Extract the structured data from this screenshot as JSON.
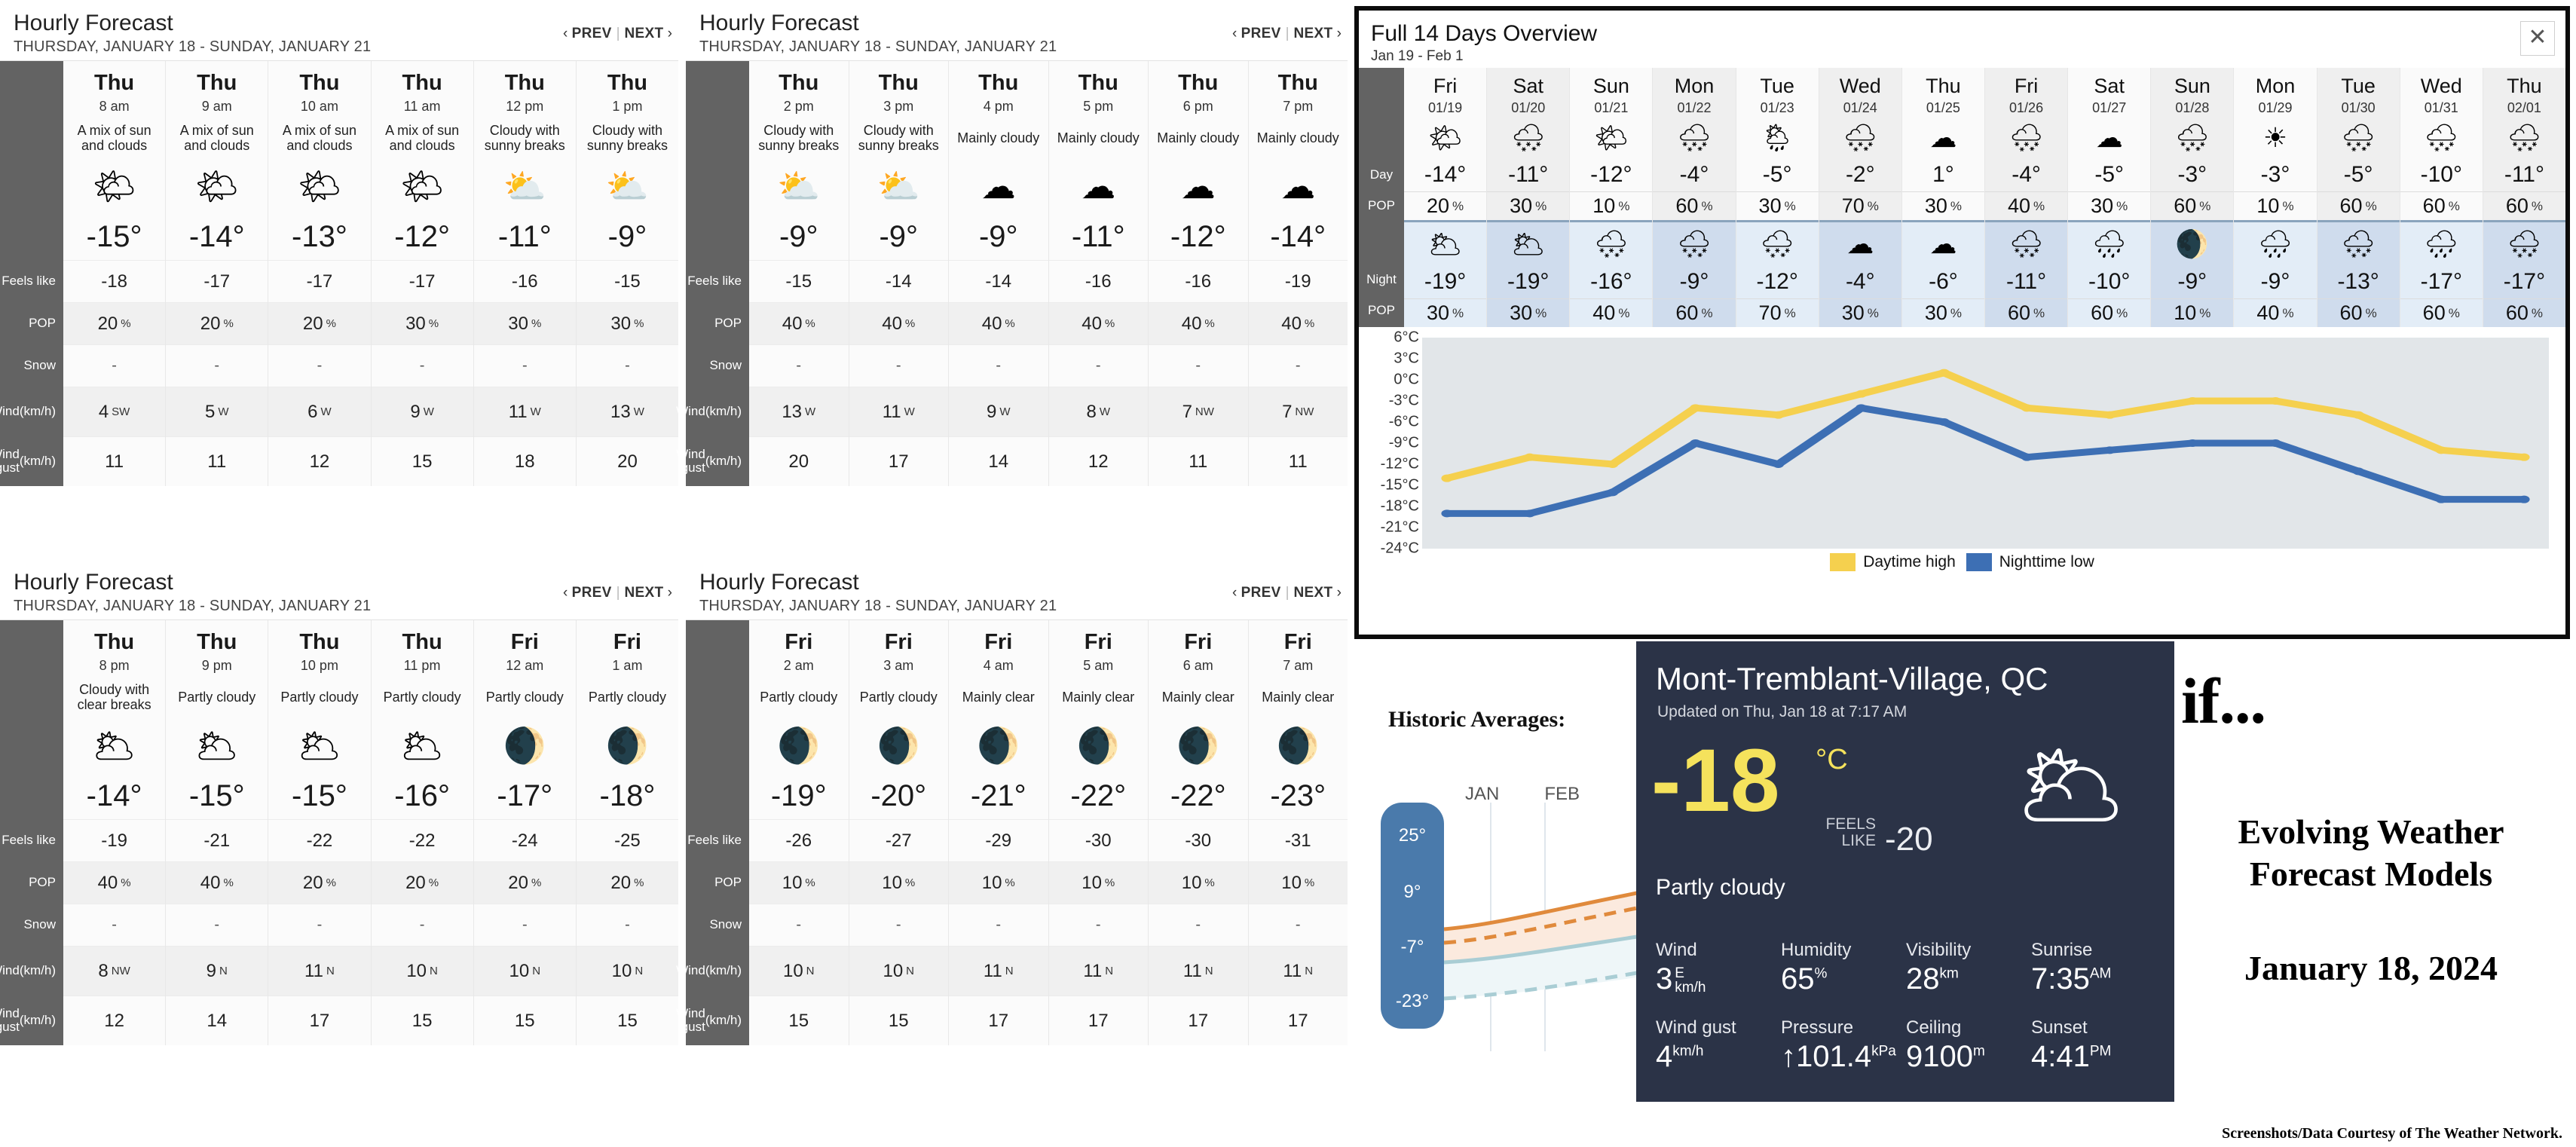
{
  "hourly_panels": [
    {
      "title": "Hourly Forecast",
      "subtitle": "THURSDAY, JANUARY 18 - SUNDAY, JANUARY 21",
      "prev_label": "PREV",
      "next_label": "NEXT",
      "row_labels": [
        "Feels like",
        "POP",
        "Snow",
        "Wind\n(km/h)",
        "Wind gust\n(km/h)"
      ],
      "columns": [
        {
          "day": "Thu",
          "time": "8 am",
          "cond": "A mix of sun and clouds",
          "icon": "sun-behind-cloud-icon",
          "glyph": "🌤",
          "temp": "-15°",
          "feels": "-18",
          "pop": "20",
          "pop_unit": "%",
          "snow": "-",
          "wind": "4",
          "wind_dir": "SW",
          "gust": "11"
        },
        {
          "day": "Thu",
          "time": "9 am",
          "cond": "A mix of sun and clouds",
          "icon": "sun-behind-cloud-icon",
          "glyph": "🌤",
          "temp": "-14°",
          "feels": "-17",
          "pop": "20",
          "pop_unit": "%",
          "snow": "-",
          "wind": "5",
          "wind_dir": "W",
          "gust": "11"
        },
        {
          "day": "Thu",
          "time": "10 am",
          "cond": "A mix of sun and clouds",
          "icon": "sun-behind-cloud-icon",
          "glyph": "🌤",
          "temp": "-13°",
          "feels": "-17",
          "pop": "20",
          "pop_unit": "%",
          "snow": "-",
          "wind": "6",
          "wind_dir": "W",
          "gust": "12"
        },
        {
          "day": "Thu",
          "time": "11 am",
          "cond": "A mix of sun and clouds",
          "icon": "sun-behind-cloud-icon",
          "glyph": "🌤",
          "temp": "-12°",
          "feels": "-17",
          "pop": "30",
          "pop_unit": "%",
          "snow": "-",
          "wind": "9",
          "wind_dir": "W",
          "gust": "15"
        },
        {
          "day": "Thu",
          "time": "12 pm",
          "cond": "Cloudy with sunny breaks",
          "icon": "sun-behind-large-cloud-icon",
          "glyph": "⛅",
          "temp": "-11°",
          "feels": "-16",
          "pop": "30",
          "pop_unit": "%",
          "snow": "-",
          "wind": "11",
          "wind_dir": "W",
          "gust": "18"
        },
        {
          "day": "Thu",
          "time": "1 pm",
          "cond": "Cloudy with sunny breaks",
          "icon": "sun-behind-large-cloud-icon",
          "glyph": "⛅",
          "temp": "-9°",
          "feels": "-15",
          "pop": "30",
          "pop_unit": "%",
          "snow": "-",
          "wind": "13",
          "wind_dir": "W",
          "gust": "20"
        }
      ]
    },
    {
      "title": "Hourly Forecast",
      "subtitle": "THURSDAY, JANUARY 18 - SUNDAY, JANUARY 21",
      "prev_label": "PREV",
      "next_label": "NEXT",
      "row_labels": [
        "Feels like",
        "POP",
        "Snow",
        "Wind\n(km/h)",
        "Wind gust\n(km/h)"
      ],
      "columns": [
        {
          "day": "Thu",
          "time": "2 pm",
          "cond": "Cloudy with sunny breaks",
          "icon": "sun-behind-large-cloud-icon",
          "glyph": "⛅",
          "temp": "-9°",
          "feels": "-15",
          "pop": "40",
          "pop_unit": "%",
          "snow": "-",
          "wind": "13",
          "wind_dir": "W",
          "gust": "20"
        },
        {
          "day": "Thu",
          "time": "3 pm",
          "cond": "Cloudy with sunny breaks",
          "icon": "sun-behind-large-cloud-icon",
          "glyph": "⛅",
          "temp": "-9°",
          "feels": "-14",
          "pop": "40",
          "pop_unit": "%",
          "snow": "-",
          "wind": "11",
          "wind_dir": "W",
          "gust": "17"
        },
        {
          "day": "Thu",
          "time": "4 pm",
          "cond": "Mainly cloudy",
          "icon": "cloud-icon",
          "glyph": "☁",
          "temp": "-9°",
          "feels": "-14",
          "pop": "40",
          "pop_unit": "%",
          "snow": "-",
          "wind": "9",
          "wind_dir": "W",
          "gust": "14"
        },
        {
          "day": "Thu",
          "time": "5 pm",
          "cond": "Mainly cloudy",
          "icon": "cloud-icon",
          "glyph": "☁",
          "temp": "-11°",
          "feels": "-16",
          "pop": "40",
          "pop_unit": "%",
          "snow": "-",
          "wind": "8",
          "wind_dir": "W",
          "gust": "12"
        },
        {
          "day": "Thu",
          "time": "6 pm",
          "cond": "Mainly cloudy",
          "icon": "cloud-icon",
          "glyph": "☁",
          "temp": "-12°",
          "feels": "-16",
          "pop": "40",
          "pop_unit": "%",
          "snow": "-",
          "wind": "7",
          "wind_dir": "NW",
          "gust": "11"
        },
        {
          "day": "Thu",
          "time": "7 pm",
          "cond": "Mainly cloudy",
          "icon": "cloud-icon",
          "glyph": "☁",
          "temp": "-14°",
          "feels": "-19",
          "pop": "40",
          "pop_unit": "%",
          "snow": "-",
          "wind": "7",
          "wind_dir": "NW",
          "gust": "11"
        }
      ]
    },
    {
      "title": "Hourly Forecast",
      "subtitle": "THURSDAY, JANUARY 18 - SUNDAY, JANUARY 21",
      "prev_label": "PREV",
      "next_label": "NEXT",
      "row_labels": [
        "Feels like",
        "POP",
        "Snow",
        "Wind\n(km/h)",
        "Wind gust\n(km/h)"
      ],
      "columns": [
        {
          "day": "Thu",
          "time": "8 pm",
          "cond": "Cloudy with clear breaks",
          "icon": "moon-behind-cloud-icon",
          "glyph": "🌥",
          "temp": "-14°",
          "feels": "-19",
          "pop": "40",
          "pop_unit": "%",
          "snow": "-",
          "wind": "8",
          "wind_dir": "NW",
          "gust": "12"
        },
        {
          "day": "Thu",
          "time": "9 pm",
          "cond": "Partly cloudy",
          "icon": "moon-behind-cloud-icon",
          "glyph": "🌥",
          "temp": "-15°",
          "feels": "-21",
          "pop": "40",
          "pop_unit": "%",
          "snow": "-",
          "wind": "9",
          "wind_dir": "N",
          "gust": "14"
        },
        {
          "day": "Thu",
          "time": "10 pm",
          "cond": "Partly cloudy",
          "icon": "moon-behind-cloud-icon",
          "glyph": "🌥",
          "temp": "-15°",
          "feels": "-22",
          "pop": "20",
          "pop_unit": "%",
          "snow": "-",
          "wind": "11",
          "wind_dir": "N",
          "gust": "17"
        },
        {
          "day": "Thu",
          "time": "11 pm",
          "cond": "Partly cloudy",
          "icon": "moon-behind-cloud-icon",
          "glyph": "🌥",
          "temp": "-16°",
          "feels": "-22",
          "pop": "20",
          "pop_unit": "%",
          "snow": "-",
          "wind": "10",
          "wind_dir": "N",
          "gust": "15"
        },
        {
          "day": "Fri",
          "time": "12 am",
          "cond": "Partly cloudy",
          "icon": "moon-behind-small-cloud-icon",
          "glyph": "🌒",
          "temp": "-17°",
          "feels": "-24",
          "pop": "20",
          "pop_unit": "%",
          "snow": "-",
          "wind": "10",
          "wind_dir": "N",
          "gust": "15"
        },
        {
          "day": "Fri",
          "time": "1 am",
          "cond": "Partly cloudy",
          "icon": "moon-behind-small-cloud-icon",
          "glyph": "🌒",
          "temp": "-18°",
          "feels": "-25",
          "pop": "20",
          "pop_unit": "%",
          "snow": "-",
          "wind": "10",
          "wind_dir": "N",
          "gust": "15"
        }
      ]
    },
    {
      "title": "Hourly Forecast",
      "subtitle": "THURSDAY, JANUARY 18 - SUNDAY, JANUARY 21",
      "prev_label": "PREV",
      "next_label": "NEXT",
      "row_labels": [
        "Feels like",
        "POP",
        "Snow",
        "Wind\n(km/h)",
        "Wind gust\n(km/h)"
      ],
      "columns": [
        {
          "day": "Fri",
          "time": "2 am",
          "cond": "Partly cloudy",
          "icon": "moon-behind-small-cloud-icon",
          "glyph": "🌒",
          "temp": "-19°",
          "feels": "-26",
          "pop": "10",
          "pop_unit": "%",
          "snow": "-",
          "wind": "10",
          "wind_dir": "N",
          "gust": "15"
        },
        {
          "day": "Fri",
          "time": "3 am",
          "cond": "Partly cloudy",
          "icon": "moon-behind-small-cloud-icon",
          "glyph": "🌒",
          "temp": "-20°",
          "feels": "-27",
          "pop": "10",
          "pop_unit": "%",
          "snow": "-",
          "wind": "10",
          "wind_dir": "N",
          "gust": "15"
        },
        {
          "day": "Fri",
          "time": "4 am",
          "cond": "Mainly clear",
          "icon": "crescent-moon-icon",
          "glyph": "🌒",
          "temp": "-21°",
          "feels": "-29",
          "pop": "10",
          "pop_unit": "%",
          "snow": "-",
          "wind": "11",
          "wind_dir": "N",
          "gust": "17"
        },
        {
          "day": "Fri",
          "time": "5 am",
          "cond": "Mainly clear",
          "icon": "crescent-moon-icon",
          "glyph": "🌒",
          "temp": "-22°",
          "feels": "-30",
          "pop": "10",
          "pop_unit": "%",
          "snow": "-",
          "wind": "11",
          "wind_dir": "N",
          "gust": "17"
        },
        {
          "day": "Fri",
          "time": "6 am",
          "cond": "Mainly clear",
          "icon": "crescent-moon-icon",
          "glyph": "🌒",
          "temp": "-22°",
          "feels": "-30",
          "pop": "10",
          "pop_unit": "%",
          "snow": "-",
          "wind": "11",
          "wind_dir": "N",
          "gust": "17"
        },
        {
          "day": "Fri",
          "time": "7 am",
          "cond": "Mainly clear",
          "icon": "crescent-moon-icon",
          "glyph": "🌒",
          "temp": "-23°",
          "feels": "-31",
          "pop": "10",
          "pop_unit": "%",
          "snow": "-",
          "wind": "11",
          "wind_dir": "N",
          "gust": "17"
        }
      ]
    }
  ],
  "overview": {
    "title": "Full 14 Days Overview",
    "subtitle": "Jan 19 - Feb 1",
    "close_icon": "close-icon",
    "row_labels": {
      "day": "Day",
      "day_pop": "POP",
      "night": "Night",
      "night_pop": "POP"
    },
    "days": [
      {
        "dow": "Fri",
        "date": "01/19",
        "day_icon": "sun-behind-cloud-icon",
        "day_glyph": "🌤",
        "day_temp": "-14°",
        "day_pop": "20",
        "night_icon": "moon-behind-cloud-icon",
        "night_glyph": "🌥",
        "night_temp": "-19°",
        "night_pop": "30"
      },
      {
        "dow": "Sat",
        "date": "01/20",
        "day_icon": "cloud-with-snow-icon",
        "day_glyph": "🌨",
        "day_temp": "-11°",
        "day_pop": "30",
        "night_icon": "moon-behind-cloud-icon",
        "night_glyph": "🌥",
        "night_temp": "-19°",
        "night_pop": "30"
      },
      {
        "dow": "Sun",
        "date": "01/21",
        "day_icon": "sun-behind-cloud-icon",
        "day_glyph": "🌤",
        "day_temp": "-12°",
        "day_pop": "10",
        "night_icon": "moon-behind-snow-cloud-icon",
        "night_glyph": "🌨",
        "night_temp": "-16°",
        "night_pop": "40"
      },
      {
        "dow": "Mon",
        "date": "01/22",
        "day_icon": "cloud-with-snow-icon",
        "day_glyph": "🌨",
        "day_temp": "-4°",
        "day_pop": "60",
        "night_icon": "cloud-with-snow-icon",
        "night_glyph": "🌨",
        "night_temp": "-9°",
        "night_pop": "60"
      },
      {
        "dow": "Tue",
        "date": "01/23",
        "day_icon": "sun-behind-rain-cloud-icon",
        "day_glyph": "🌦",
        "day_temp": "-5°",
        "day_pop": "30",
        "night_icon": "cloud-with-snow-icon",
        "night_glyph": "🌨",
        "night_temp": "-12°",
        "night_pop": "70"
      },
      {
        "dow": "Wed",
        "date": "01/24",
        "day_icon": "cloud-with-snow-icon",
        "day_glyph": "🌨",
        "day_temp": "-2°",
        "day_pop": "70",
        "night_icon": "cloud-icon",
        "night_glyph": "☁",
        "night_temp": "-4°",
        "night_pop": "30"
      },
      {
        "dow": "Thu",
        "date": "01/25",
        "day_icon": "cloud-icon",
        "day_glyph": "☁",
        "day_temp": "1°",
        "day_pop": "30",
        "night_icon": "cloud-icon",
        "night_glyph": "☁",
        "night_temp": "-6°",
        "night_pop": "30"
      },
      {
        "dow": "Fri",
        "date": "01/26",
        "day_icon": "cloud-with-snow-icon",
        "day_glyph": "🌨",
        "day_temp": "-4°",
        "day_pop": "40",
        "night_icon": "cloud-with-snow-icon",
        "night_glyph": "🌨",
        "night_temp": "-11°",
        "night_pop": "60"
      },
      {
        "dow": "Sat",
        "date": "01/27",
        "day_icon": "cloud-icon",
        "day_glyph": "☁",
        "day_temp": "-5°",
        "day_pop": "30",
        "night_icon": "moon-behind-rain-cloud-icon",
        "night_glyph": "🌧",
        "night_temp": "-10°",
        "night_pop": "60"
      },
      {
        "dow": "Sun",
        "date": "01/28",
        "day_icon": "sun-behind-snow-cloud-icon",
        "day_glyph": "🌨",
        "day_temp": "-3°",
        "day_pop": "60",
        "night_icon": "crescent-moon-icon",
        "night_glyph": "🌒",
        "night_temp": "-9°",
        "night_pop": "10"
      },
      {
        "dow": "Mon",
        "date": "01/29",
        "day_icon": "sun-icon",
        "day_glyph": "☀",
        "day_temp": "-3°",
        "day_pop": "10",
        "night_icon": "moon-behind-rain-cloud-icon",
        "night_glyph": "🌧",
        "night_temp": "-9°",
        "night_pop": "40"
      },
      {
        "dow": "Tue",
        "date": "01/30",
        "day_icon": "cloud-with-snow-icon",
        "day_glyph": "🌨",
        "day_temp": "-5°",
        "day_pop": "60",
        "night_icon": "cloud-with-snow-icon",
        "night_glyph": "🌨",
        "night_temp": "-13°",
        "night_pop": "60"
      },
      {
        "dow": "Wed",
        "date": "01/31",
        "day_icon": "cloud-with-snow-icon",
        "day_glyph": "🌨",
        "day_temp": "-10°",
        "day_pop": "60",
        "night_icon": "moon-behind-rain-cloud-icon",
        "night_glyph": "🌧",
        "night_temp": "-17°",
        "night_pop": "60"
      },
      {
        "dow": "Thu",
        "date": "02/01",
        "day_icon": "cloud-with-snow-icon",
        "day_glyph": "🌨",
        "day_temp": "-11°",
        "day_pop": "60",
        "night_icon": "cloud-with-snow-icon",
        "night_glyph": "🌨",
        "night_temp": "-17°",
        "night_pop": "60"
      }
    ]
  },
  "chart_data": {
    "type": "line",
    "title": "",
    "xlabel": "",
    "ylabel": "",
    "ylim": [
      -24,
      6
    ],
    "yticks": [
      "6°C",
      "3°C",
      "0°C",
      "-3°C",
      "-6°C",
      "-9°C",
      "-12°C",
      "-15°C",
      "-18°C",
      "-21°C",
      "-24°C"
    ],
    "grid": false,
    "legend_position": "bottom",
    "x": [
      "01/19",
      "01/20",
      "01/21",
      "01/22",
      "01/23",
      "01/24",
      "01/25",
      "01/26",
      "01/27",
      "01/28",
      "01/29",
      "01/30",
      "01/31",
      "02/01"
    ],
    "series": [
      {
        "name": "Daytime high",
        "color": "#f5d04e",
        "values": [
          -14,
          -11,
          -12,
          -4,
          -5,
          -2,
          1,
          -4,
          -5,
          -3,
          -3,
          -5,
          -10,
          -11
        ]
      },
      {
        "name": "Nighttime low",
        "color": "#3d6fb4",
        "values": [
          -19,
          -19,
          -16,
          -9,
          -12,
          -4,
          -6,
          -11,
          -10,
          -9,
          -9,
          -13,
          -17,
          -17
        ]
      }
    ]
  },
  "historic": {
    "title": "Historic Averages:",
    "months": [
      "JAN",
      "FEB"
    ],
    "scale_labels": [
      "25°",
      "9°",
      "-7°",
      "-23°"
    ]
  },
  "current": {
    "location": "Mont-Tremblant-Village, QC",
    "updated": "Updated on Thu, Jan 18 at 7:17 AM",
    "temp": "-18",
    "unit": "°C",
    "feels_like_label_line1": "FEELS",
    "feels_like_label_line2": "LIKE",
    "feels_like_value": "-20",
    "condition": "Partly cloudy",
    "icon": "moon-behind-cloud-icon",
    "icon_glyph": "🌥",
    "accent_color": "#f5e25c",
    "background_color": "#2b3347",
    "stats": [
      {
        "label": "Wind",
        "value": "3",
        "sup": "",
        "stack_top": "E",
        "stack_bottom": "km/h"
      },
      {
        "label": "Humidity",
        "value": "65",
        "sup": "%",
        "stack_top": "",
        "stack_bottom": ""
      },
      {
        "label": "Visibility",
        "value": "28",
        "sup": "km",
        "stack_top": "",
        "stack_bottom": ""
      },
      {
        "label": "Sunrise",
        "value": "7:35",
        "sup": "AM",
        "stack_top": "",
        "stack_bottom": ""
      },
      {
        "label": "Wind gust",
        "value": "4",
        "sup": "km/h",
        "stack_top": "",
        "stack_bottom": ""
      },
      {
        "label": "Pressure",
        "value": "↑101.4",
        "sup": "kPa",
        "stack_top": "",
        "stack_bottom": ""
      },
      {
        "label": "Ceiling",
        "value": "9100",
        "sup": "m",
        "stack_top": "",
        "stack_bottom": ""
      },
      {
        "label": "Sunset",
        "value": "4:41",
        "sup": "PM",
        "stack_top": "",
        "stack_bottom": ""
      }
    ]
  },
  "title_block": {
    "if": "if...",
    "headline_line1": "Evolving Weather",
    "headline_line2": "Forecast Models",
    "date": "January 18, 2024"
  },
  "credit": "Screenshots/Data Courtesy of The Weather Network."
}
